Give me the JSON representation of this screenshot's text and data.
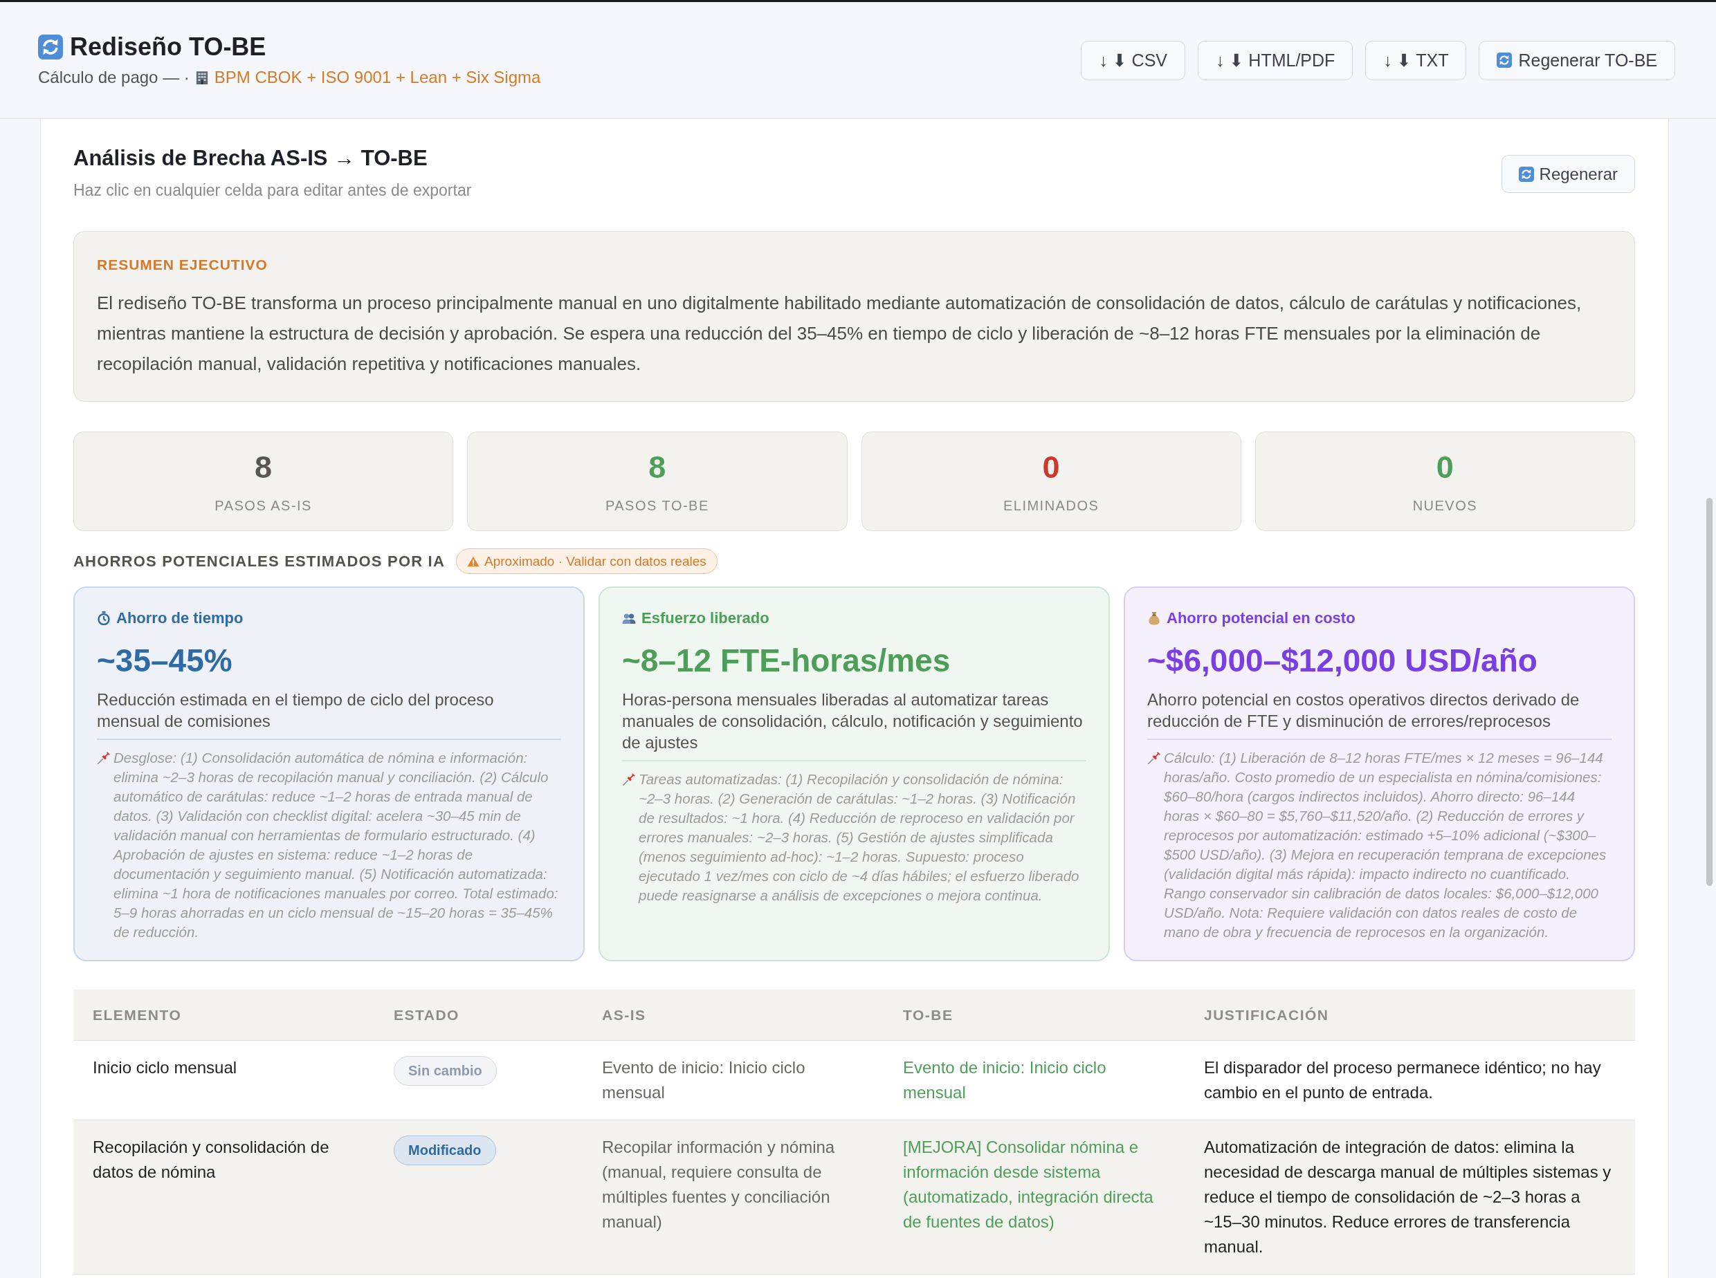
{
  "header": {
    "title": "Rediseño TO-BE",
    "subtitle": "Cálculo de pago — ·",
    "framework": "BPM CBOK + ISO 9001 + Lean + Six Sigma",
    "buttons": [
      {
        "kind": "export",
        "label": "↓ ⬇ CSV"
      },
      {
        "kind": "export",
        "label": "↓ ⬇ HTML/PDF"
      },
      {
        "kind": "export",
        "label": "↓ ⬇ TXT"
      },
      {
        "kind": "regenerate",
        "label": "Regenerar TO-BE"
      }
    ]
  },
  "gap_analysis": {
    "title": "Análisis de Brecha AS-IS → TO-BE",
    "hint": "Haz clic en cualquier celda para editar antes de exportar",
    "regenerate_button": "Regenerar",
    "summary": {
      "label": "RESUMEN EJECUTIVO",
      "text": "El rediseño TO-BE transforma un proceso principalmente manual en uno digitalmente habilitado mediante automatización de consolidación de datos, cálculo de carátulas y notificaciones, mientras mantiene la estructura de decisión y aprobación. Se espera una reducción del 35–45% en tiempo de ciclo y liberación de ~8–12 horas FTE mensuales por la eliminación de recopilación manual, validación repetitiva y notificaciones manuales."
    },
    "stats": [
      {
        "value": "8",
        "label": "PASOS AS-IS",
        "color": "#5a5550"
      },
      {
        "value": "8",
        "label": "PASOS TO-BE",
        "color": "#4d9e58"
      },
      {
        "value": "0",
        "label": "ELIMINADOS",
        "color": "#c93a2e"
      },
      {
        "value": "0",
        "label": "NUEVOS",
        "color": "#4d9e58"
      }
    ],
    "savings": {
      "heading": "AHORROS POTENCIALES ESTIMADOS POR IA",
      "badge": "Aproximado · Validar con datos reales",
      "cards": [
        {
          "kind": "time",
          "title": "Ahorro de tiempo",
          "value": "~35–45%",
          "description": "Reducción estimada en el tiempo de ciclo del proceso mensual de comisiones",
          "note": "Desglose: (1) Consolidación automática de nómina e información: elimina ~2–3 horas de recopilación manual y conciliación. (2) Cálculo automático de carátulas: reduce ~1–2 horas de entrada manual de datos. (3) Validación con checklist digital: acelera ~30–45 min de validación manual con herramientas de formulario estructurado. (4) Aprobación de ajustes en sistema: reduce ~1–2 horas de documentación y seguimiento manual. (5) Notificación automatizada: elimina ~1 hora de notificaciones manuales por correo. Total estimado: 5–9 horas ahorradas en un ciclo mensual de ~15–20 horas = 35–45% de reducción."
        },
        {
          "kind": "effort",
          "title": "Esfuerzo liberado",
          "value": "~8–12 FTE-horas/mes",
          "description": "Horas-persona mensuales liberadas al automatizar tareas manuales de consolidación, cálculo, notificación y seguimiento de ajustes",
          "note": "Tareas automatizadas: (1) Recopilación y consolidación de nómina: ~2–3 horas. (2) Generación de carátulas: ~1–2 horas. (3) Notificación de resultados: ~1 hora. (4) Reducción de reproceso en validación por errores manuales: ~2–3 horas. (5) Gestión de ajustes simplificada (menos seguimiento ad-hoc): ~1–2 horas. Supuesto: proceso ejecutado 1 vez/mes con ciclo de ~4 días hábiles; el esfuerzo liberado puede reasignarse a análisis de excepciones o mejora continua."
        },
        {
          "kind": "cost",
          "title": "Ahorro potencial en costo",
          "value": "~$6,000–$12,000 USD/año",
          "description": "Ahorro potencial en costos operativos directos derivado de reducción de FTE y disminución de errores/reprocesos",
          "note": "Cálculo: (1) Liberación de 8–12 horas FTE/mes × 12 meses = 96–144 horas/año. Costo promedio de un especialista en nómina/comisiones: $60–80/hora (cargos indirectos incluidos). Ahorro directo: 96–144 horas × $60–80 = $5,760–$11,520/año. (2) Reducción de errores y reprocesos por automatización: estimado +5–10% adicional (~$300–$500 USD/año). (3) Mejora en recuperación temprana de excepciones (validación digital más rápida): impacto indirecto no cuantificado. Rango conservador sin calibración de datos locales: $6,000–$12,000 USD/año. Nota: Requiere validación con datos reales de costo de mano de obra y frecuencia de reprocesos en la organización."
        }
      ]
    },
    "table": {
      "columns": [
        "ELEMENTO",
        "ESTADO",
        "AS-IS",
        "TO-BE",
        "JUSTIFICACIÓN"
      ],
      "rows": [
        {
          "element": "Inicio ciclo mensual",
          "status": {
            "label": "Sin cambio",
            "kind": "unchanged"
          },
          "as_is": "Evento de inicio: Inicio ciclo mensual",
          "to_be": "Evento de inicio: Inicio ciclo mensual",
          "justification": "El disparador del proceso permanece idéntico; no hay cambio en el punto de entrada."
        },
        {
          "element": "Recopilación y consolidación de datos de nómina",
          "status": {
            "label": "Modificado",
            "kind": "modified"
          },
          "as_is": "Recopilar información y nómina (manual, requiere consulta de múltiples fuentes y conciliación manual)",
          "to_be": "[MEJORA] Consolidar nómina e información desde sistema (automatizado, integración directa de fuentes de datos)",
          "justification": "Automatización de integración de datos: elimina la necesidad de descarga manual de múltiples sistemas y reduce el tiempo de consolidación de ~2–3 horas a ~15–30 minutos. Reduce errores de transferencia manual."
        }
      ]
    }
  }
}
